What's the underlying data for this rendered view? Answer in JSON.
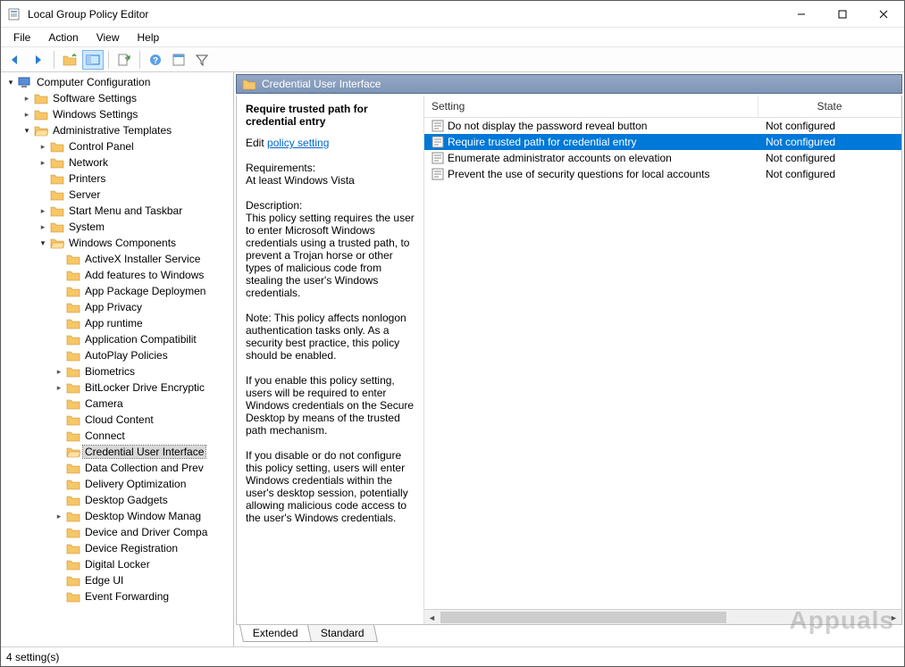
{
  "window": {
    "title": "Local Group Policy Editor"
  },
  "menu": {
    "items": [
      "File",
      "Action",
      "View",
      "Help"
    ]
  },
  "toolbar": {
    "buttons": [
      {
        "name": "back-button",
        "icon": "arrow-left"
      },
      {
        "name": "forward-button",
        "icon": "arrow-right"
      },
      {
        "name": "up-button",
        "icon": "folder-up"
      },
      {
        "name": "show-hide-tree-button",
        "icon": "panel-toggle",
        "active": true
      },
      {
        "name": "export-list-button",
        "icon": "export"
      },
      {
        "name": "help-button",
        "icon": "help"
      },
      {
        "name": "properties-button",
        "icon": "properties"
      },
      {
        "name": "filter-button",
        "icon": "filter"
      }
    ]
  },
  "tree": {
    "root": {
      "label": "Computer Configuration",
      "icon": "computer",
      "expanded": true,
      "children": [
        {
          "label": "Software Settings",
          "icon": "folder",
          "expanded": false,
          "hasChildren": true
        },
        {
          "label": "Windows Settings",
          "icon": "folder",
          "expanded": false,
          "hasChildren": true
        },
        {
          "label": "Administrative Templates",
          "icon": "folder-open",
          "expanded": true,
          "hasChildren": true,
          "children": [
            {
              "label": "Control Panel",
              "icon": "folder",
              "hasChildren": true
            },
            {
              "label": "Network",
              "icon": "folder",
              "hasChildren": true
            },
            {
              "label": "Printers",
              "icon": "folder"
            },
            {
              "label": "Server",
              "icon": "folder"
            },
            {
              "label": "Start Menu and Taskbar",
              "icon": "folder",
              "hasChildren": true
            },
            {
              "label": "System",
              "icon": "folder",
              "hasChildren": true
            },
            {
              "label": "Windows Components",
              "icon": "folder-open",
              "expanded": true,
              "hasChildren": true,
              "children": [
                {
                  "label": "ActiveX Installer Service",
                  "icon": "folder"
                },
                {
                  "label": "Add features to Windows",
                  "icon": "folder"
                },
                {
                  "label": "App Package Deploymen",
                  "icon": "folder"
                },
                {
                  "label": "App Privacy",
                  "icon": "folder"
                },
                {
                  "label": "App runtime",
                  "icon": "folder"
                },
                {
                  "label": "Application Compatibilit",
                  "icon": "folder"
                },
                {
                  "label": "AutoPlay Policies",
                  "icon": "folder"
                },
                {
                  "label": "Biometrics",
                  "icon": "folder",
                  "hasChildren": true
                },
                {
                  "label": "BitLocker Drive Encryptic",
                  "icon": "folder",
                  "hasChildren": true
                },
                {
                  "label": "Camera",
                  "icon": "folder"
                },
                {
                  "label": "Cloud Content",
                  "icon": "folder"
                },
                {
                  "label": "Connect",
                  "icon": "folder"
                },
                {
                  "label": "Credential User Interface",
                  "icon": "folder-open",
                  "selected": true
                },
                {
                  "label": "Data Collection and Prev",
                  "icon": "folder"
                },
                {
                  "label": "Delivery Optimization",
                  "icon": "folder"
                },
                {
                  "label": "Desktop Gadgets",
                  "icon": "folder"
                },
                {
                  "label": "Desktop Window Manag",
                  "icon": "folder",
                  "hasChildren": true
                },
                {
                  "label": "Device and Driver Compa",
                  "icon": "folder"
                },
                {
                  "label": "Device Registration",
                  "icon": "folder"
                },
                {
                  "label": "Digital Locker",
                  "icon": "folder"
                },
                {
                  "label": "Edge UI",
                  "icon": "folder"
                },
                {
                  "label": "Event Forwarding",
                  "icon": "folder"
                }
              ]
            }
          ]
        }
      ]
    }
  },
  "breadcrumb": {
    "label": "Credential User Interface"
  },
  "description": {
    "title": "Require trusted path for credential entry",
    "editPrefix": "Edit ",
    "editLink": "policy setting",
    "reqLabel": "Requirements:",
    "reqText": "At least Windows Vista",
    "descLabel": "Description:",
    "p1": "This policy setting requires the user to enter Microsoft Windows credentials using a trusted path, to prevent a Trojan horse or other types of malicious code from stealing the user's Windows credentials.",
    "p2": "Note: This policy affects nonlogon authentication tasks only. As a security best practice, this policy should be enabled.",
    "p3": "If you enable this policy setting, users will be required to enter Windows credentials on the Secure Desktop by means of the trusted path mechanism.",
    "p4": "If you disable or do not configure this policy setting, users will enter Windows credentials within the user's desktop session, potentially allowing malicious code access to the user's Windows credentials."
  },
  "list": {
    "columns": {
      "setting": "Setting",
      "state": "State"
    },
    "rows": [
      {
        "setting": "Do not display the password reveal button",
        "state": "Not configured",
        "selected": false
      },
      {
        "setting": "Require trusted path for credential entry",
        "state": "Not configured",
        "selected": true
      },
      {
        "setting": "Enumerate administrator accounts on elevation",
        "state": "Not configured",
        "selected": false
      },
      {
        "setting": "Prevent the use of security questions for local accounts",
        "state": "Not configured",
        "selected": false
      }
    ]
  },
  "tabs": {
    "extended": "Extended",
    "standard": "Standard"
  },
  "statusbar": {
    "text": "4 setting(s)"
  },
  "watermark": "Appuals"
}
